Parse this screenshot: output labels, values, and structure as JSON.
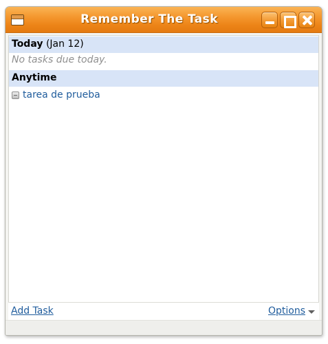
{
  "window": {
    "title": "Remember The Task"
  },
  "sections": {
    "today": {
      "heading": "Today",
      "date": "(Jan 12)",
      "empty_message": "No tasks due today."
    },
    "anytime": {
      "heading": "Anytime",
      "tasks": [
        {
          "name": "tarea de prueba"
        }
      ]
    }
  },
  "footer": {
    "add_task_label": "Add Task",
    "options_label": "Options"
  },
  "icons": {
    "window_menu": "window-menu-icon",
    "minimize": "minimize-icon",
    "maximize": "maximize-icon",
    "close": "close-icon",
    "task_checkbox": "task-checkbox-icon",
    "options_dropdown": "chevron-down-icon"
  },
  "colors": {
    "titlebar_accent": "#ef8a1c",
    "section_header_bg": "#d8e4f7",
    "link": "#1f5c9c",
    "muted_text": "#909090"
  }
}
